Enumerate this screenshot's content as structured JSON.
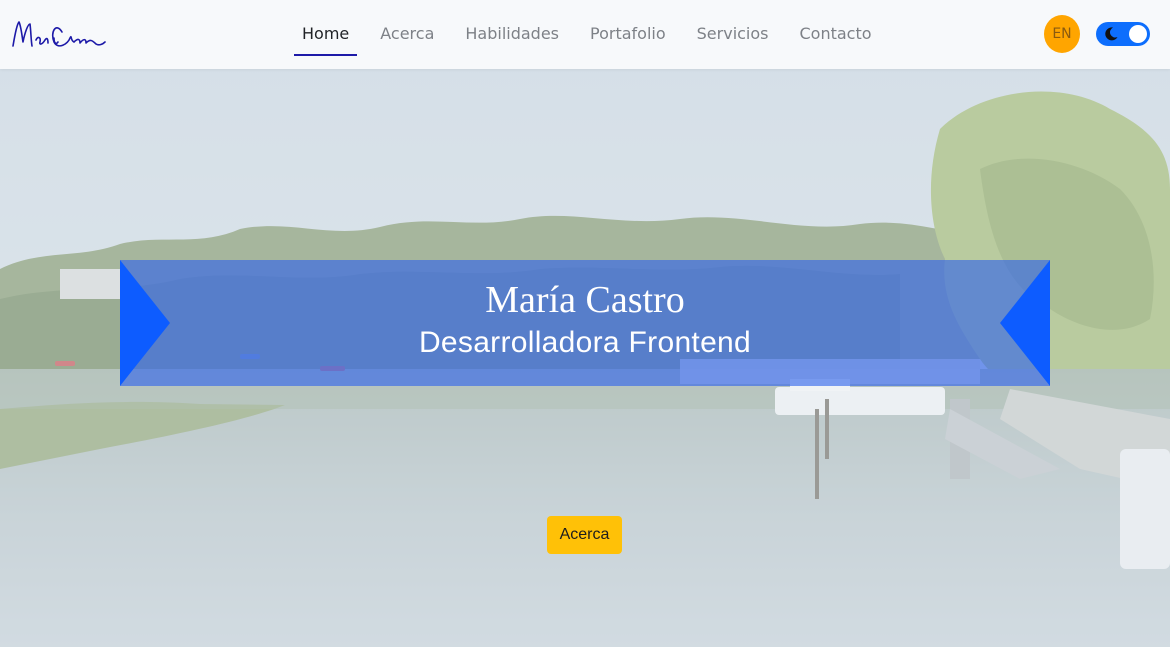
{
  "navbar": {
    "logo_alt": "Mari Castro signature logo",
    "links": [
      {
        "label": "Home",
        "active": true
      },
      {
        "label": "Acerca",
        "active": false
      },
      {
        "label": "Habilidades",
        "active": false
      },
      {
        "label": "Portafolio",
        "active": false
      },
      {
        "label": "Servicios",
        "active": false
      },
      {
        "label": "Contacto",
        "active": false
      }
    ],
    "lang_button": "EN",
    "theme_toggle_icon": "moon-icon"
  },
  "hero": {
    "name": "María Castro",
    "role": "Desarrolladora Frontend",
    "cta_label": "Acerca"
  },
  "colors": {
    "nav_active_underline": "#1d1aa8",
    "banner": "#2f62eb",
    "banner_arrow": "#0d5cff",
    "lang_button": "#ffa500",
    "toggle": "#0d6efd",
    "cta": "#ffc107"
  }
}
